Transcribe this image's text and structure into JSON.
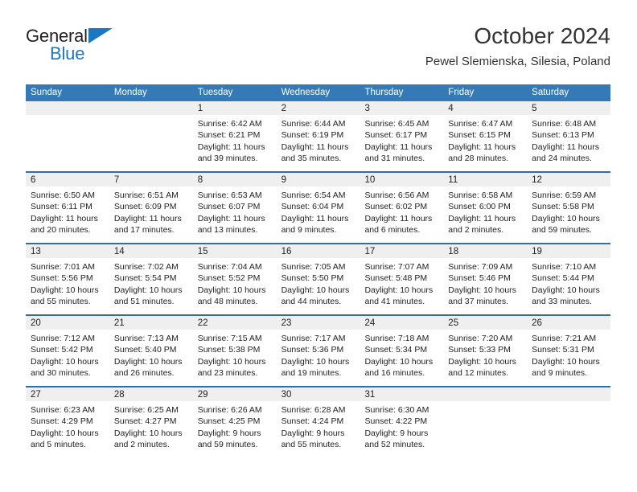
{
  "logo": {
    "word_one": "General",
    "word_two": "Blue",
    "triangle_color": "#1c77c3",
    "text_color": "#231f20"
  },
  "header": {
    "title": "October 2024",
    "subtitle": "Pewel Slemienska, Silesia, Poland"
  },
  "theme": {
    "header_blue": "#337ab7",
    "divider_blue": "#2f6fa8",
    "date_band_gray": "#efefef",
    "text": "#222222"
  },
  "weekdays": [
    "Sunday",
    "Monday",
    "Tuesday",
    "Wednesday",
    "Thursday",
    "Friday",
    "Saturday"
  ],
  "weeks": [
    {
      "dates": [
        "",
        "",
        "1",
        "2",
        "3",
        "4",
        "5"
      ],
      "cells": [
        {
          "sunrise": "",
          "sunset": "",
          "daylight": ""
        },
        {
          "sunrise": "",
          "sunset": "",
          "daylight": ""
        },
        {
          "sunrise": "Sunrise: 6:42 AM",
          "sunset": "Sunset: 6:21 PM",
          "daylight": "Daylight: 11 hours and 39 minutes."
        },
        {
          "sunrise": "Sunrise: 6:44 AM",
          "sunset": "Sunset: 6:19 PM",
          "daylight": "Daylight: 11 hours and 35 minutes."
        },
        {
          "sunrise": "Sunrise: 6:45 AM",
          "sunset": "Sunset: 6:17 PM",
          "daylight": "Daylight: 11 hours and 31 minutes."
        },
        {
          "sunrise": "Sunrise: 6:47 AM",
          "sunset": "Sunset: 6:15 PM",
          "daylight": "Daylight: 11 hours and 28 minutes."
        },
        {
          "sunrise": "Sunrise: 6:48 AM",
          "sunset": "Sunset: 6:13 PM",
          "daylight": "Daylight: 11 hours and 24 minutes."
        }
      ]
    },
    {
      "dates": [
        "6",
        "7",
        "8",
        "9",
        "10",
        "11",
        "12"
      ],
      "cells": [
        {
          "sunrise": "Sunrise: 6:50 AM",
          "sunset": "Sunset: 6:11 PM",
          "daylight": "Daylight: 11 hours and 20 minutes."
        },
        {
          "sunrise": "Sunrise: 6:51 AM",
          "sunset": "Sunset: 6:09 PM",
          "daylight": "Daylight: 11 hours and 17 minutes."
        },
        {
          "sunrise": "Sunrise: 6:53 AM",
          "sunset": "Sunset: 6:07 PM",
          "daylight": "Daylight: 11 hours and 13 minutes."
        },
        {
          "sunrise": "Sunrise: 6:54 AM",
          "sunset": "Sunset: 6:04 PM",
          "daylight": "Daylight: 11 hours and 9 minutes."
        },
        {
          "sunrise": "Sunrise: 6:56 AM",
          "sunset": "Sunset: 6:02 PM",
          "daylight": "Daylight: 11 hours and 6 minutes."
        },
        {
          "sunrise": "Sunrise: 6:58 AM",
          "sunset": "Sunset: 6:00 PM",
          "daylight": "Daylight: 11 hours and 2 minutes."
        },
        {
          "sunrise": "Sunrise: 6:59 AM",
          "sunset": "Sunset: 5:58 PM",
          "daylight": "Daylight: 10 hours and 59 minutes."
        }
      ]
    },
    {
      "dates": [
        "13",
        "14",
        "15",
        "16",
        "17",
        "18",
        "19"
      ],
      "cells": [
        {
          "sunrise": "Sunrise: 7:01 AM",
          "sunset": "Sunset: 5:56 PM",
          "daylight": "Daylight: 10 hours and 55 minutes."
        },
        {
          "sunrise": "Sunrise: 7:02 AM",
          "sunset": "Sunset: 5:54 PM",
          "daylight": "Daylight: 10 hours and 51 minutes."
        },
        {
          "sunrise": "Sunrise: 7:04 AM",
          "sunset": "Sunset: 5:52 PM",
          "daylight": "Daylight: 10 hours and 48 minutes."
        },
        {
          "sunrise": "Sunrise: 7:05 AM",
          "sunset": "Sunset: 5:50 PM",
          "daylight": "Daylight: 10 hours and 44 minutes."
        },
        {
          "sunrise": "Sunrise: 7:07 AM",
          "sunset": "Sunset: 5:48 PM",
          "daylight": "Daylight: 10 hours and 41 minutes."
        },
        {
          "sunrise": "Sunrise: 7:09 AM",
          "sunset": "Sunset: 5:46 PM",
          "daylight": "Daylight: 10 hours and 37 minutes."
        },
        {
          "sunrise": "Sunrise: 7:10 AM",
          "sunset": "Sunset: 5:44 PM",
          "daylight": "Daylight: 10 hours and 33 minutes."
        }
      ]
    },
    {
      "dates": [
        "20",
        "21",
        "22",
        "23",
        "24",
        "25",
        "26"
      ],
      "cells": [
        {
          "sunrise": "Sunrise: 7:12 AM",
          "sunset": "Sunset: 5:42 PM",
          "daylight": "Daylight: 10 hours and 30 minutes."
        },
        {
          "sunrise": "Sunrise: 7:13 AM",
          "sunset": "Sunset: 5:40 PM",
          "daylight": "Daylight: 10 hours and 26 minutes."
        },
        {
          "sunrise": "Sunrise: 7:15 AM",
          "sunset": "Sunset: 5:38 PM",
          "daylight": "Daylight: 10 hours and 23 minutes."
        },
        {
          "sunrise": "Sunrise: 7:17 AM",
          "sunset": "Sunset: 5:36 PM",
          "daylight": "Daylight: 10 hours and 19 minutes."
        },
        {
          "sunrise": "Sunrise: 7:18 AM",
          "sunset": "Sunset: 5:34 PM",
          "daylight": "Daylight: 10 hours and 16 minutes."
        },
        {
          "sunrise": "Sunrise: 7:20 AM",
          "sunset": "Sunset: 5:33 PM",
          "daylight": "Daylight: 10 hours and 12 minutes."
        },
        {
          "sunrise": "Sunrise: 7:21 AM",
          "sunset": "Sunset: 5:31 PM",
          "daylight": "Daylight: 10 hours and 9 minutes."
        }
      ]
    },
    {
      "dates": [
        "27",
        "28",
        "29",
        "30",
        "31",
        "",
        ""
      ],
      "cells": [
        {
          "sunrise": "Sunrise: 6:23 AM",
          "sunset": "Sunset: 4:29 PM",
          "daylight": "Daylight: 10 hours and 5 minutes."
        },
        {
          "sunrise": "Sunrise: 6:25 AM",
          "sunset": "Sunset: 4:27 PM",
          "daylight": "Daylight: 10 hours and 2 minutes."
        },
        {
          "sunrise": "Sunrise: 6:26 AM",
          "sunset": "Sunset: 4:25 PM",
          "daylight": "Daylight: 9 hours and 59 minutes."
        },
        {
          "sunrise": "Sunrise: 6:28 AM",
          "sunset": "Sunset: 4:24 PM",
          "daylight": "Daylight: 9 hours and 55 minutes."
        },
        {
          "sunrise": "Sunrise: 6:30 AM",
          "sunset": "Sunset: 4:22 PM",
          "daylight": "Daylight: 9 hours and 52 minutes."
        },
        {
          "sunrise": "",
          "sunset": "",
          "daylight": ""
        },
        {
          "sunrise": "",
          "sunset": "",
          "daylight": ""
        }
      ]
    }
  ]
}
